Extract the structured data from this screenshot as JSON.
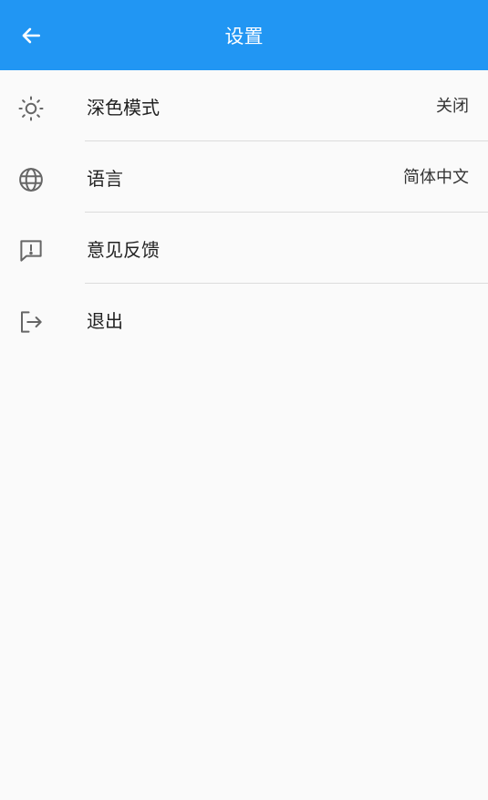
{
  "header": {
    "title": "设置",
    "back_icon": "arrow-left-icon",
    "background_color": "#2196f3"
  },
  "settings": {
    "items": [
      {
        "icon": "sun-icon",
        "label": "深色模式",
        "value": "关闭"
      },
      {
        "icon": "globe-icon",
        "label": "语言",
        "value": "简体中文"
      },
      {
        "icon": "feedback-icon",
        "label": "意见反馈"
      },
      {
        "icon": "logout-icon",
        "label": "退出"
      }
    ]
  }
}
